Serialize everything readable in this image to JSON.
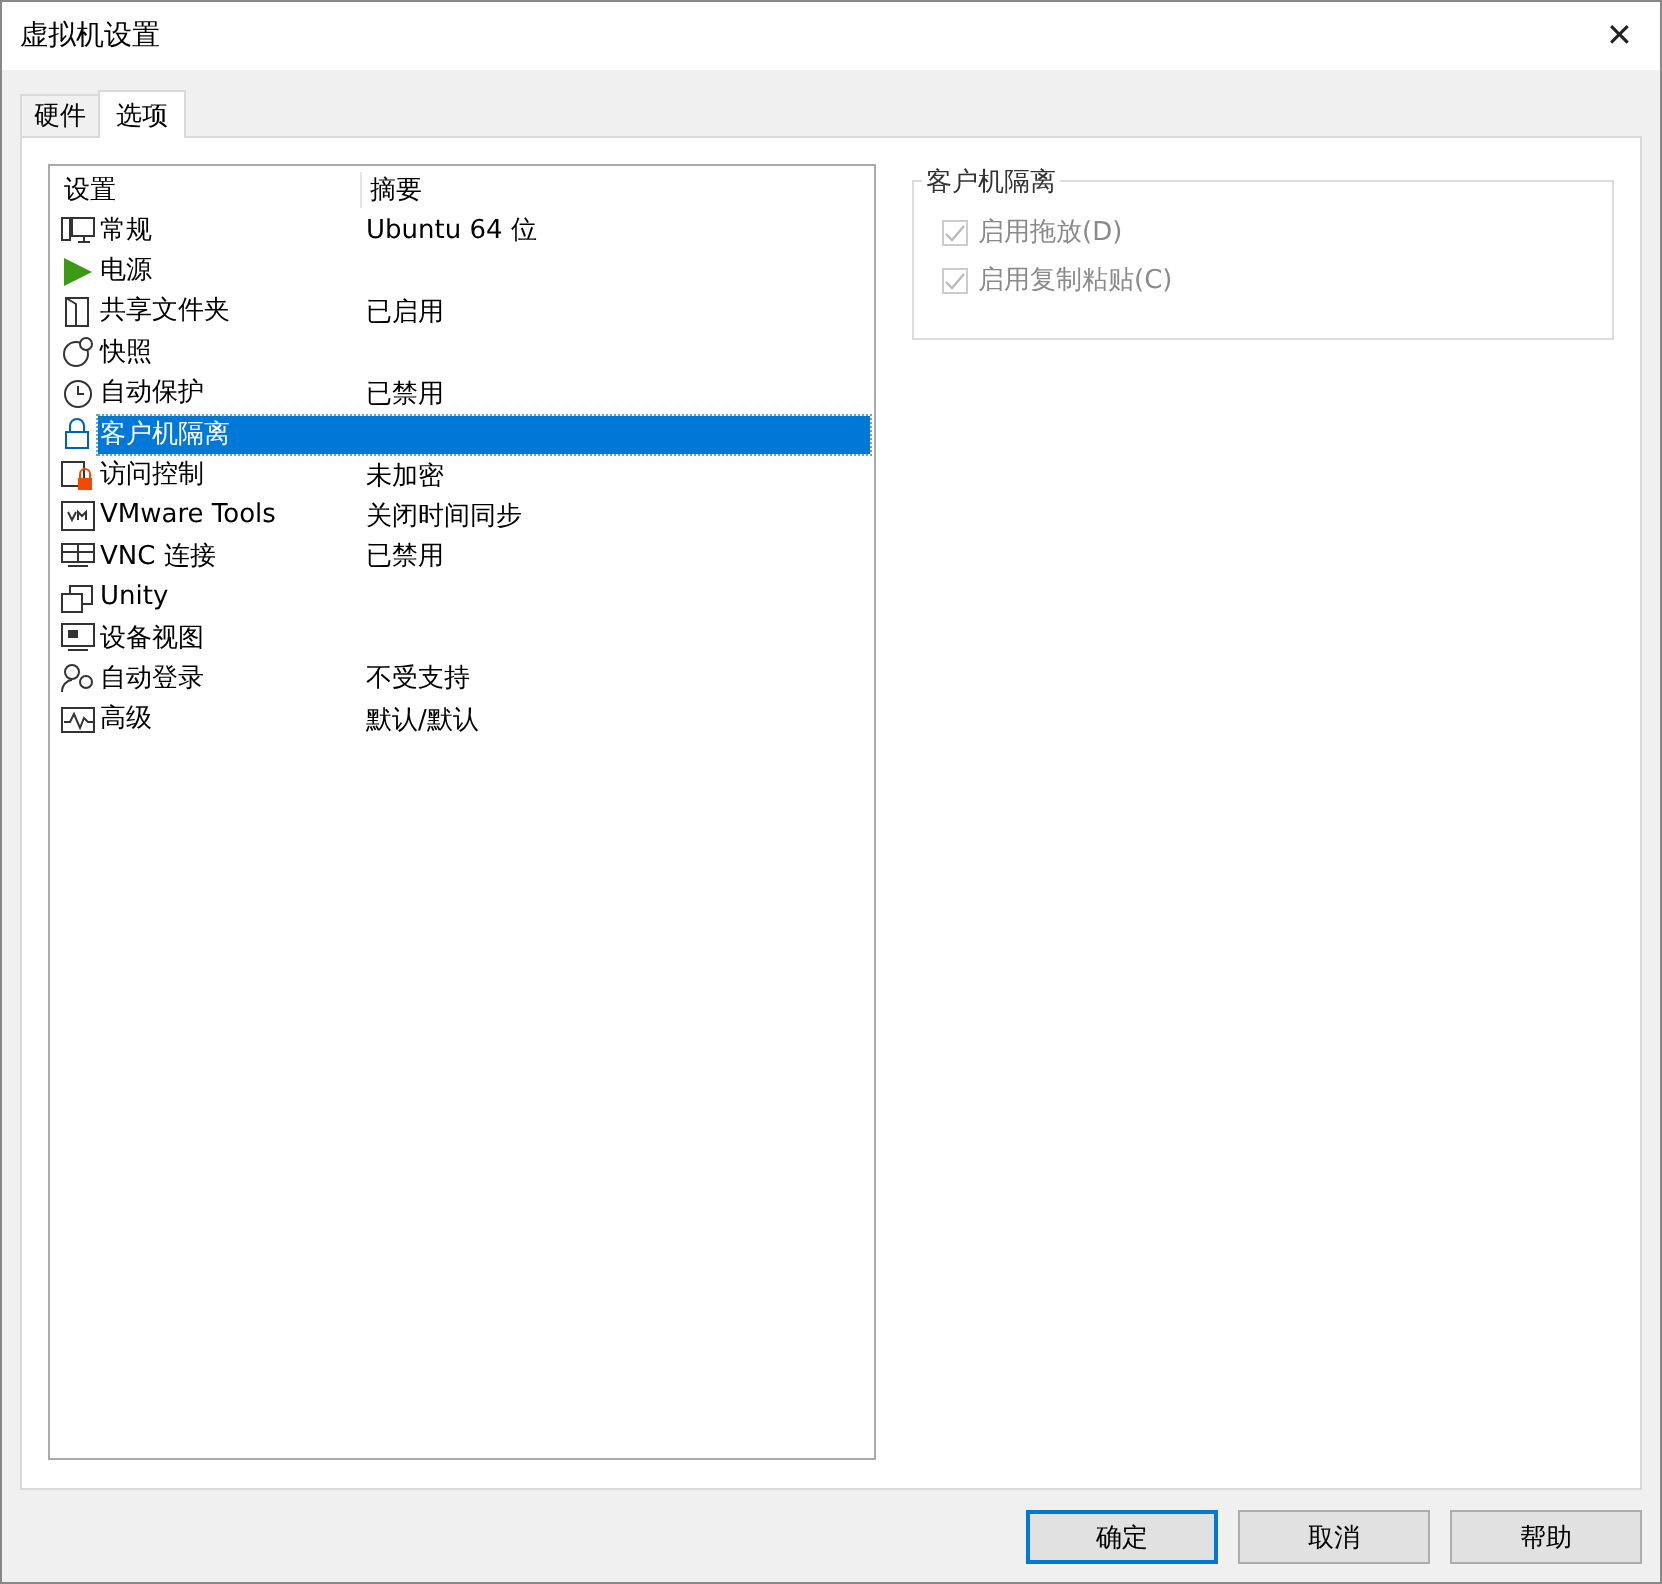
{
  "window": {
    "title": "虚拟机设置",
    "close": "✕"
  },
  "tabs": [
    {
      "label": "硬件",
      "selected": false
    },
    {
      "label": "选项",
      "selected": true
    }
  ],
  "settings_list": {
    "columns": [
      "设置",
      "摘要"
    ],
    "rows": [
      {
        "name": "常规",
        "summary": "Ubuntu 64 位",
        "selected": false
      },
      {
        "name": "电源",
        "selected": false
      },
      {
        "name": "共享文件夹",
        "summary": "已启用",
        "selected": false
      },
      {
        "name": "快照",
        "selected": false
      },
      {
        "name": "自动保护",
        "summary": "已禁用",
        "selected": false
      },
      {
        "name": "客户机隔离",
        "selected": true
      },
      {
        "name": "访问控制",
        "summary": "未加密",
        "selected": false
      },
      {
        "name": "VMware Tools",
        "summary": "关闭时间同步",
        "selected": false
      },
      {
        "name": "VNC 连接",
        "summary": "已禁用",
        "selected": false
      },
      {
        "name": "Unity",
        "selected": false
      },
      {
        "name": "设备视图",
        "selected": false
      },
      {
        "name": "自动登录",
        "summary": "不受支持",
        "selected": false
      },
      {
        "name": "高级",
        "summary": "默认/默认",
        "selected": false
      }
    ]
  },
  "group": {
    "title": "客户机隔离",
    "options": [
      {
        "label": "启用拖放(D)",
        "checked": true,
        "disabled": true
      },
      {
        "label": "启用复制粘贴(C)",
        "checked": true,
        "disabled": true
      }
    ]
  },
  "buttons": [
    {
      "label": "确定",
      "default": true
    },
    {
      "label": "取消",
      "default": false
    },
    {
      "label": "帮助",
      "default": false
    }
  ]
}
